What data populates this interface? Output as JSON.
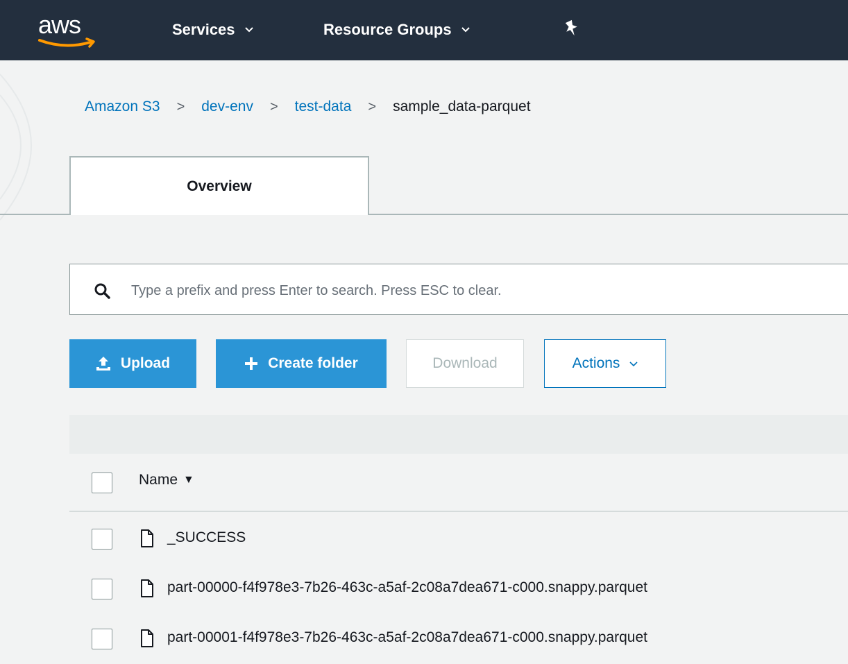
{
  "topnav": {
    "logo_text": "aws",
    "services_label": "Services",
    "resource_groups_label": "Resource Groups",
    "nav_bg_color": "#232f3e"
  },
  "breadcrumb": {
    "items": [
      "Amazon S3",
      "dev-env",
      "test-data"
    ],
    "current": "sample_data-parquet",
    "separator": ">"
  },
  "tabs": {
    "overview_label": "Overview"
  },
  "search": {
    "placeholder": "Type a prefix and press Enter to search. Press ESC to clear.",
    "value": ""
  },
  "toolbar": {
    "upload_label": "Upload",
    "create_folder_label": "Create folder",
    "download_label": "Download",
    "actions_label": "Actions",
    "accent_color": "#2b95d6"
  },
  "table": {
    "name_header": "Name",
    "sort_indicator": "▼",
    "rows": [
      {
        "name": "_SUCCESS",
        "icon": "file-icon"
      },
      {
        "name": "part-00000-f4f978e3-7b26-463c-a5af-2c08a7dea671-c000.snappy.parquet",
        "icon": "file-icon"
      },
      {
        "name": "part-00001-f4f978e3-7b26-463c-a5af-2c08a7dea671-c000.snappy.parquet",
        "icon": "file-icon"
      }
    ]
  }
}
